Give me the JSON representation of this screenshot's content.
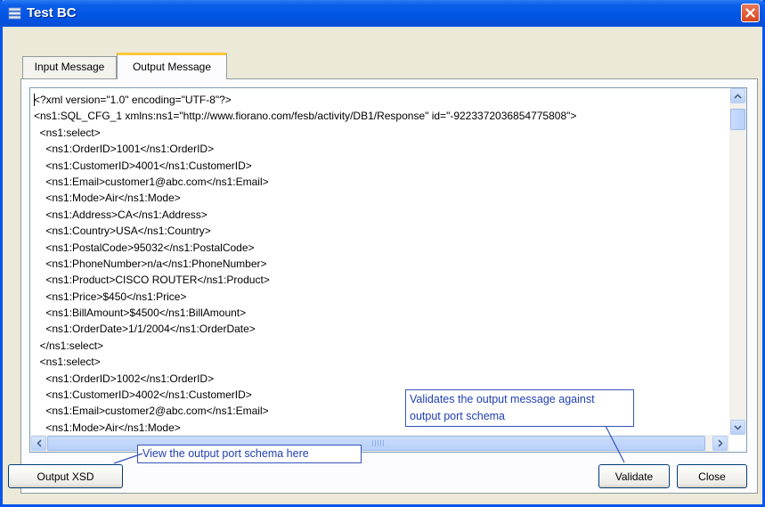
{
  "window": {
    "title": "Test BC",
    "app_icon": "database-icon",
    "close_icon": "close-icon",
    "colors": {
      "titlebar": "#0054e3",
      "close": "#d8461b",
      "callout_text": "#1f3fb0"
    }
  },
  "tabs": [
    {
      "label": "Input Message",
      "selected": false
    },
    {
      "label": "Output Message",
      "selected": true
    }
  ],
  "message": {
    "lines": [
      "<?xml version=\"1.0\" encoding=\"UTF-8\"?>",
      "<ns1:SQL_CFG_1 xmlns:ns1=\"http://www.fiorano.com/fesb/activity/DB1/Response\" id=\"-9223372036854775808\">",
      "  <ns1:select>",
      "    <ns1:OrderID>1001</ns1:OrderID>",
      "    <ns1:CustomerID>4001</ns1:CustomerID>",
      "    <ns1:Email>customer1@abc.com</ns1:Email>",
      "    <ns1:Mode>Air</ns1:Mode>",
      "    <ns1:Address>CA</ns1:Address>",
      "    <ns1:Country>USA</ns1:Country>",
      "    <ns1:PostalCode>95032</ns1:PostalCode>",
      "    <ns1:PhoneNumber>n/a</ns1:PhoneNumber>",
      "    <ns1:Product>CISCO ROUTER</ns1:Product>",
      "    <ns1:Price>$450</ns1:Price>",
      "    <ns1:BillAmount>$4500</ns1:BillAmount>",
      "    <ns1:OrderDate>1/1/2004</ns1:OrderDate>",
      "  </ns1:select>",
      "  <ns1:select>",
      "    <ns1:OrderID>1002</ns1:OrderID>",
      "    <ns1:CustomerID>4002</ns1:CustomerID>",
      "    <ns1:Email>customer2@abc.com</ns1:Email>",
      "    <ns1:Mode>Air</ns1:Mode>"
    ]
  },
  "buttons": {
    "output_xsd": "Output XSD",
    "validate": "Validate",
    "close": "Close"
  },
  "callouts": {
    "schema": "View the output port schema here",
    "validate_line1": "Validates the output message against",
    "validate_line2": "output port schema"
  }
}
